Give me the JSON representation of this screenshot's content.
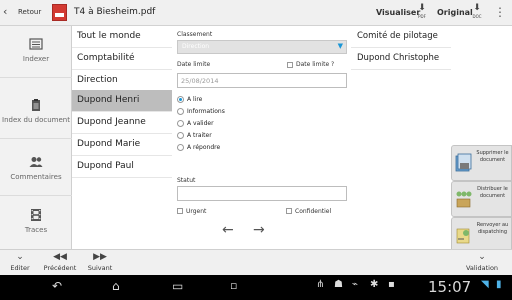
{
  "topbar": {
    "back_label": "Retour",
    "doc_title": "T4 à Biesheim.pdf",
    "view_label": "Visualiser",
    "view_badge": "PDF",
    "original_label": "Original",
    "original_badge": "DOC"
  },
  "sidebar": {
    "items": [
      {
        "label": "Indexer",
        "icon": "index-icon"
      },
      {
        "label": "Index du document",
        "icon": "clipboard-icon"
      },
      {
        "label": "Commentaires",
        "icon": "users-icon"
      },
      {
        "label": "Traces",
        "icon": "film-icon"
      }
    ]
  },
  "recipients": [
    "Tout le monde",
    "Comptabilité",
    "Direction",
    "Dupond Henri",
    "Dupond Jeanne",
    "Dupond Marie",
    "Dupond Paul"
  ],
  "selected_recipient": "Dupond Henri",
  "form": {
    "classement_label": "Classement",
    "classement_placeholder": "Direction",
    "date_limite_label": "Date limite",
    "date_limite_check_label": "Date limite ?",
    "date_value": "25/08/2014",
    "actions": [
      {
        "label": "A lire",
        "selected": true
      },
      {
        "label": "Informations",
        "selected": false
      },
      {
        "label": "A valider",
        "selected": false
      },
      {
        "label": "A traiter",
        "selected": false
      },
      {
        "label": "A répondre",
        "selected": false
      }
    ],
    "statut_label": "Statut",
    "statut_value": "",
    "urgent_label": "Urgent",
    "confidentiel_label": "Confidentiel"
  },
  "right_list": [
    "Comité de pilotage",
    "Dupond Christophe"
  ],
  "actions_panel": [
    {
      "label": "Supprimer le document",
      "icon": "delete-document-icon"
    },
    {
      "label": "Distribuer le document",
      "icon": "distribute-icon"
    },
    {
      "label": "Renvoyer au dispatching",
      "icon": "send-back-icon"
    }
  ],
  "bottombar": {
    "edit_label": "Editer",
    "prev_label": "Précédent",
    "next_label": "Suivant",
    "validate_label": "Validation"
  },
  "system": {
    "clock": "15:07"
  },
  "colors": {
    "accent": "#1a96d6",
    "selected_row": "#bdbdbd",
    "pdf_red": "#d33a32"
  }
}
